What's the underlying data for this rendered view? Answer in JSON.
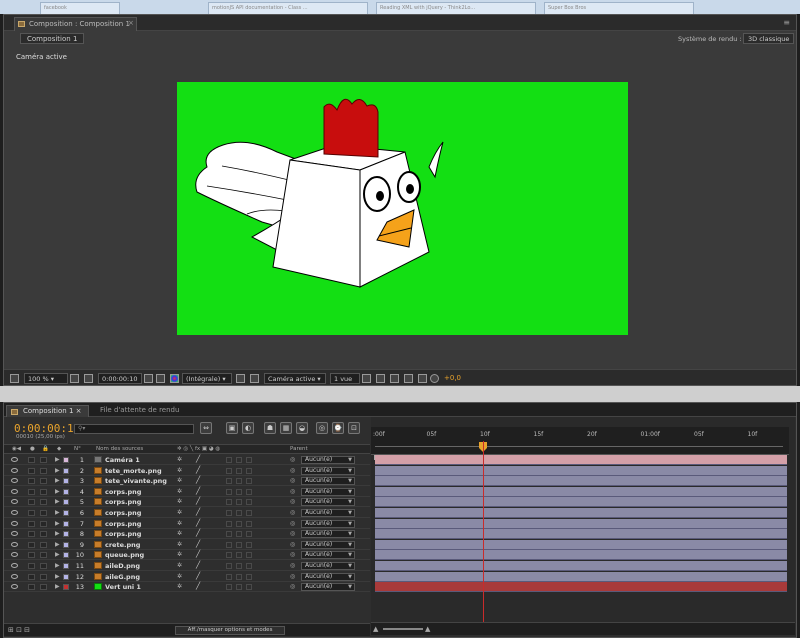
{
  "browser": {
    "tabs": [
      "facebook",
      "motionJS API documentation - Class ...",
      "Reading XML with jQuery - Think2Lo...",
      "Super Box Bros"
    ]
  },
  "comp_panel": {
    "tab_label": "Composition : Composition 1",
    "tab_close": "×",
    "crumb": "Composition 1",
    "renderer_label": "Système de rendu :",
    "renderer_value": "3D classique",
    "active_camera_label": "Caméra active",
    "viewer_bg": "#13df13",
    "footer": {
      "zoom": "100 %",
      "timecode": "0:00:00:10",
      "resolution": "(Intégrale)",
      "view": "Caméra active",
      "view_count": "1 vue",
      "exposure": "+0,0"
    }
  },
  "timeline": {
    "tab_active": "Composition 1",
    "tab_other": "File d'attente de rendu",
    "timecode": "0:00:00:10",
    "fps": "00010 (25,00 ips)",
    "search_glyph": "⚲▾",
    "headers": {
      "num": "N°",
      "name": "Nom des sources",
      "parent": "Parent"
    },
    "layers": [
      {
        "num": "1",
        "name": "Caméra 1",
        "color": "#d9b7d9",
        "is_camera": true
      },
      {
        "num": "2",
        "name": "tete_morte.png",
        "color": "#b3b3e6"
      },
      {
        "num": "3",
        "name": "tete_vivante.png",
        "color": "#b3b3e6"
      },
      {
        "num": "4",
        "name": "corps.png",
        "color": "#b3b3e6"
      },
      {
        "num": "5",
        "name": "corps.png",
        "color": "#b3b3e6"
      },
      {
        "num": "6",
        "name": "corps.png",
        "color": "#b3b3e6"
      },
      {
        "num": "7",
        "name": "corps.png",
        "color": "#b3b3e6"
      },
      {
        "num": "8",
        "name": "corps.png",
        "color": "#b3b3e6"
      },
      {
        "num": "9",
        "name": "crete.png",
        "color": "#b3b3e6"
      },
      {
        "num": "10",
        "name": "queue.png",
        "color": "#b3b3e6"
      },
      {
        "num": "11",
        "name": "aileD.png",
        "color": "#b3b3e6"
      },
      {
        "num": "12",
        "name": "aileG.png",
        "color": "#b3b3e6"
      },
      {
        "num": "13",
        "name": "Vert uni 1",
        "color": "#c23131",
        "is_solid": true
      }
    ],
    "parent_value": "Aucun(e)",
    "footer_toggle": "Aff./masquer options et modes",
    "ruler_ticks": [
      ":00f",
      "05f",
      "10f",
      "15f",
      "20f",
      "01:00f",
      "05f",
      "10f"
    ],
    "bar_color": "#8a8aa6",
    "camera_bar_color": "#d4a0a8",
    "solid_bar_color": "#a83a3a",
    "cti_color": "#e8a32c"
  }
}
